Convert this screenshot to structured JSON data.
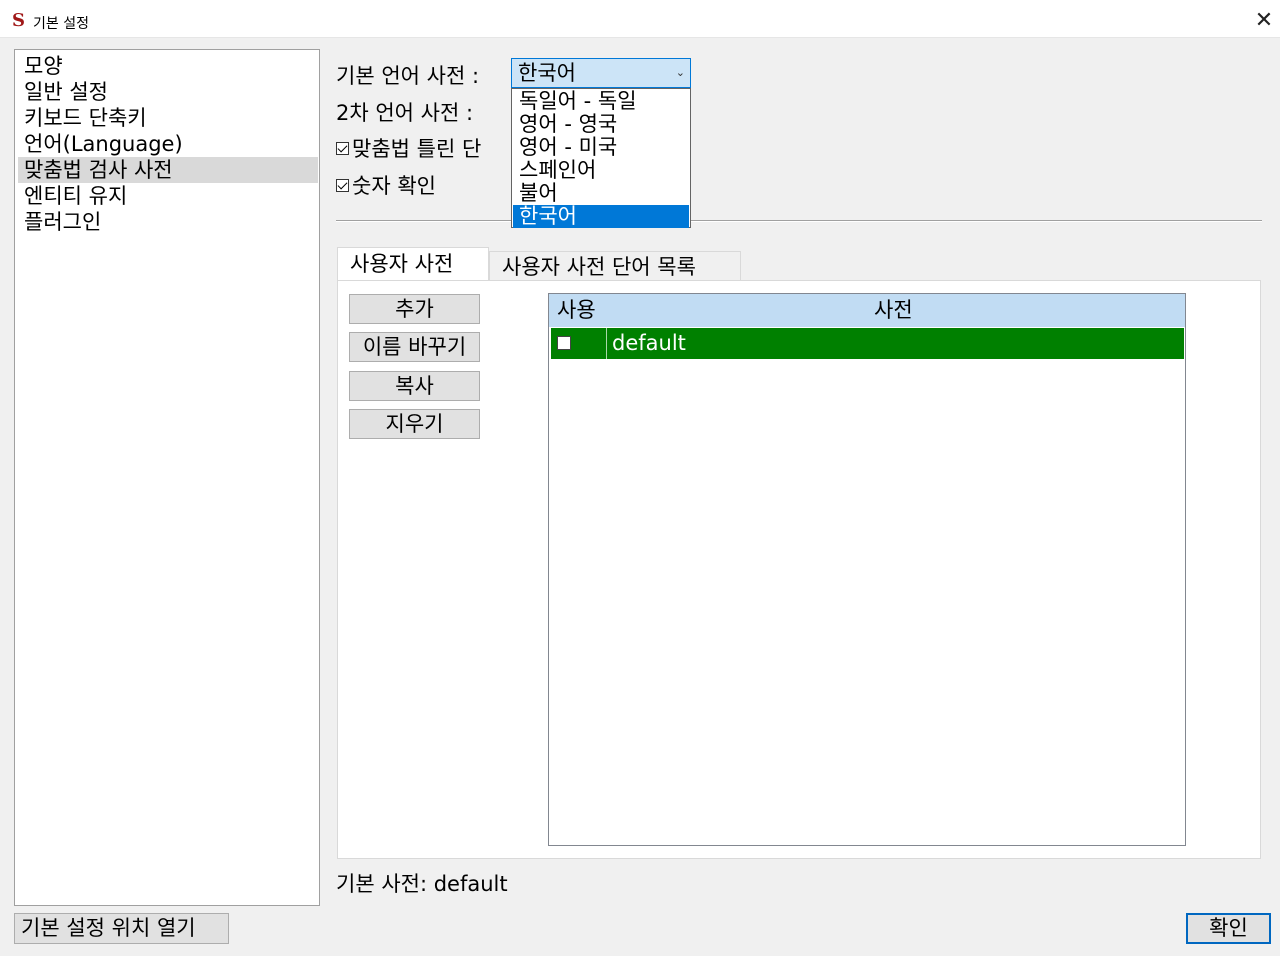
{
  "window": {
    "title": "기본 설정",
    "logo": "S",
    "close_glyph": "✕"
  },
  "nav": {
    "items": [
      "모양",
      "일반 설정",
      "키보드 단축키",
      "언어(Language)",
      "맞춤법 검사 사전",
      "엔티티 유지",
      "플러그인"
    ],
    "selected_index": 4
  },
  "settings": {
    "primary_dict_label": "기본 언어 사전 :",
    "primary_dict_value": "한국어",
    "combo_arrow": "⌄",
    "secondary_dict_label": "2차 언어 사전 :",
    "spell_check_label": "맞춤법 틀린 단",
    "spell_check_checked": true,
    "number_check_label": "숫자 확인",
    "number_check_checked": true,
    "dropdown_options": [
      "독일어 - 독일",
      "영어 - 영국",
      "영어 - 미국",
      "스페인어",
      "불어",
      "한국어"
    ],
    "dropdown_selected_index": 5
  },
  "tabs": [
    "사용자 사전",
    "사용자 사전 단어 목록"
  ],
  "buttons": {
    "add": "추가",
    "rename": "이름 바꾸기",
    "copy": "복사",
    "delete": "지우기",
    "open_location": "기본 설정 위치 열기",
    "ok": "확인"
  },
  "table": {
    "headers": [
      "사용",
      "사전"
    ],
    "rows": [
      {
        "use": false,
        "name": "default"
      }
    ],
    "row_highlight_color": "#008000"
  },
  "status": {
    "default_dict_text": "기본 사전: default"
  }
}
